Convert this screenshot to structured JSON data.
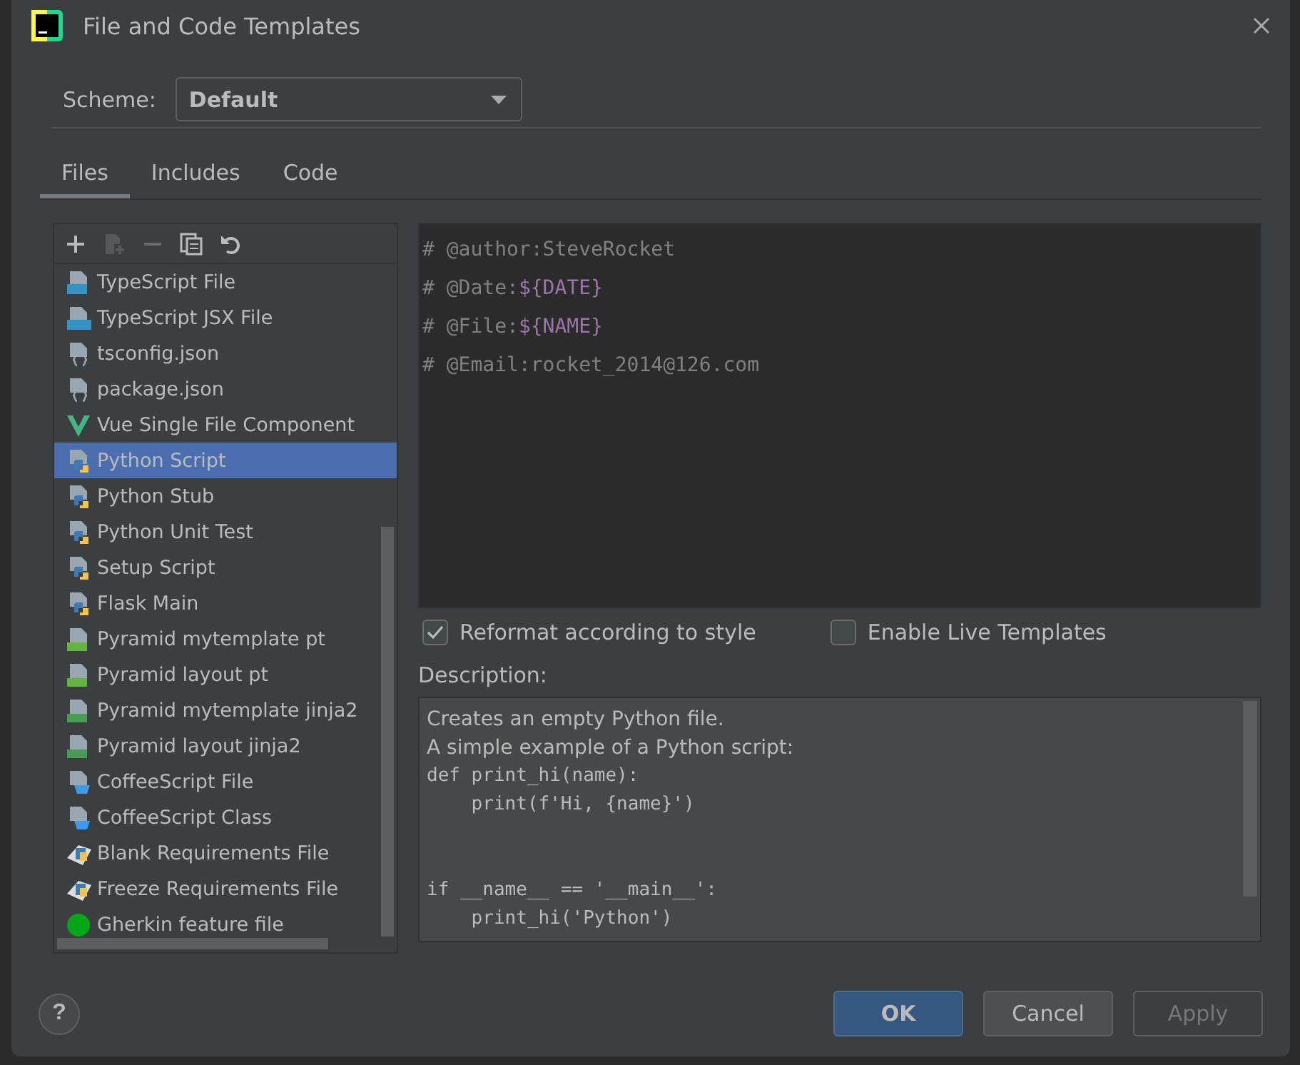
{
  "window": {
    "title": "File and Code Templates"
  },
  "scheme": {
    "label": "Scheme:",
    "value": "Default"
  },
  "tabs": [
    {
      "label": "Files",
      "selected": true
    },
    {
      "label": "Includes",
      "selected": false
    },
    {
      "label": "Code",
      "selected": false
    }
  ],
  "toolbar": [
    {
      "kind": "add",
      "disabled": false
    },
    {
      "kind": "add-child",
      "disabled": true
    },
    {
      "kind": "remove",
      "disabled": true
    },
    {
      "kind": "copy",
      "disabled": false
    },
    {
      "kind": "reset",
      "disabled": false
    }
  ],
  "templates": [
    {
      "label": "TypeScript File",
      "kind": "ts",
      "selected": false
    },
    {
      "label": "TypeScript JSX File",
      "kind": "tsx",
      "selected": false
    },
    {
      "label": "tsconfig.json",
      "kind": "json",
      "selected": false
    },
    {
      "label": "package.json",
      "kind": "json",
      "selected": false
    },
    {
      "label": "Vue Single File Component",
      "kind": "vue",
      "selected": false
    },
    {
      "label": "Python Script",
      "kind": "python",
      "selected": true
    },
    {
      "label": "Python Stub",
      "kind": "python",
      "selected": false
    },
    {
      "label": "Python Unit Test",
      "kind": "python",
      "selected": false
    },
    {
      "label": "Setup Script",
      "kind": "python",
      "selected": false
    },
    {
      "label": "Flask Main",
      "kind": "python",
      "selected": false
    },
    {
      "label": "Pyramid mytemplate pt",
      "kind": "chameleon",
      "selected": false
    },
    {
      "label": "Pyramid layout pt",
      "kind": "chameleon",
      "selected": false
    },
    {
      "label": "Pyramid mytemplate jinja2",
      "kind": "jinja",
      "selected": false
    },
    {
      "label": "Pyramid layout jinja2",
      "kind": "jinja",
      "selected": false
    },
    {
      "label": "CoffeeScript File",
      "kind": "coffee",
      "selected": false
    },
    {
      "label": "CoffeeScript Class",
      "kind": "coffee",
      "selected": false
    },
    {
      "label": "Blank Requirements File",
      "kind": "requirements",
      "selected": false
    },
    {
      "label": "Freeze Requirements File",
      "kind": "requirements",
      "selected": false
    },
    {
      "label": "Gherkin feature file",
      "kind": "gherkin",
      "selected": false
    }
  ],
  "editor": {
    "lines": [
      [
        {
          "text": "# @author:SteveRocket",
          "kind": "comment"
        }
      ],
      [
        {
          "text": "# @Date:",
          "kind": "comment"
        },
        {
          "text": "${DATE}",
          "kind": "variable"
        }
      ],
      [
        {
          "text": "# @File:",
          "kind": "comment"
        },
        {
          "text": "${NAME}",
          "kind": "variable"
        }
      ],
      [
        {
          "text": "# @Email:rocket_2014@126.com",
          "kind": "comment"
        }
      ]
    ]
  },
  "options": [
    {
      "label": "Reformat according to style",
      "checked": true
    },
    {
      "label": "Enable Live Templates",
      "checked": false
    }
  ],
  "description": {
    "label": "Description:",
    "lines": [
      {
        "text": "Creates an empty Python file.",
        "kind": "prose"
      },
      {
        "text": "A simple example of a Python script:",
        "kind": "prose"
      },
      {
        "text": "def print_hi(name):",
        "kind": "code"
      },
      {
        "text": "    print(f'Hi, {name}')",
        "kind": "code"
      },
      {
        "kind": "blank"
      },
      {
        "kind": "blank"
      },
      {
        "text": "if __name__ == '__main__':",
        "kind": "code"
      },
      {
        "text": "    print_hi('Python')",
        "kind": "code"
      }
    ]
  },
  "help": {
    "label": "?"
  },
  "buttons": [
    {
      "label": "OK",
      "kind": "default",
      "disabled": false
    },
    {
      "label": "Cancel",
      "kind": "normal",
      "disabled": false
    },
    {
      "label": "Apply",
      "kind": "normal",
      "disabled": true
    }
  ]
}
